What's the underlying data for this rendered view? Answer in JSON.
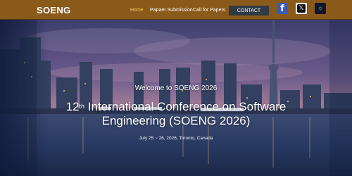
{
  "header": {
    "brand": "SOENG",
    "nav": [
      {
        "label": "Home",
        "active": true
      },
      {
        "label": "Papaer Submission",
        "active": false
      },
      {
        "label": "Call for Papers",
        "active": false
      }
    ],
    "contact_label": "CONTACT",
    "social": [
      {
        "icon": "facebook-icon",
        "glyph": "f"
      },
      {
        "icon": "x-twitter-icon",
        "glyph": "𝕏"
      },
      {
        "icon": "app-icon",
        "glyph": "⌬"
      }
    ],
    "colors": {
      "bar": "#8a5a1a",
      "active_link": "#f2d25a",
      "contact_bg": "#2f3a44"
    }
  },
  "hero": {
    "welcome": "Welcome to SOENG 2026",
    "ordinal_number": "12",
    "ordinal_suffix": "th",
    "title_rest": " International Conference on Software",
    "title_line2": "Engineering (SOENG 2026)",
    "date_location": "July 25 ~ 26, 2026, Toronto, Canada"
  }
}
